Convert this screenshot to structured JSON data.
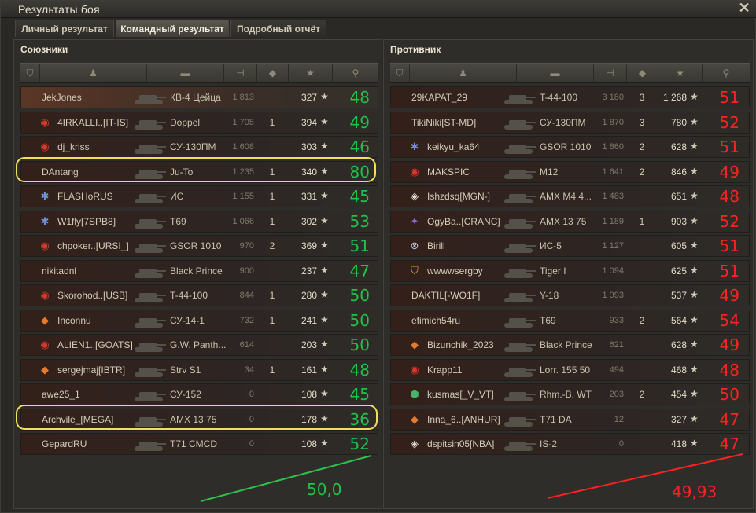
{
  "window": {
    "title": "Результаты боя"
  },
  "tabs": [
    {
      "label": "Личный результат",
      "active": false
    },
    {
      "label": "Командный результат",
      "active": true
    },
    {
      "label": "Подробный отчёт",
      "active": false
    }
  ],
  "allies": {
    "title": "Союзники",
    "total": "50,0",
    "rows": [
      {
        "player": "JekJones",
        "clan_icon": "",
        "vehicle": "КВ-4 Цейца",
        "damage": "1 813",
        "kills": "",
        "xp": "327",
        "note": "48",
        "style": "top"
      },
      {
        "player": "4IRKALLI..[IT-IS]",
        "clan_icon": "clan-emblem-red",
        "vehicle": "Doppel",
        "damage": "1 705",
        "kills": "1",
        "xp": "394",
        "note": "49",
        "style": "dark"
      },
      {
        "player": "dj_kriss",
        "clan_icon": "clan-emblem-red",
        "vehicle": "СУ-130ПМ",
        "damage": "1 608",
        "kills": "",
        "xp": "303",
        "note": "46",
        "style": "dark"
      },
      {
        "player": "DAntang",
        "clan_icon": "",
        "vehicle": "Ju-To",
        "damage": "1 235",
        "kills": "1",
        "xp": "340",
        "note": "80",
        "style": "dark"
      },
      {
        "player": "FLASHoRUS",
        "clan_icon": "clan-emblem-blue",
        "vehicle": "ИС",
        "damage": "1 155",
        "kills": "1",
        "xp": "331",
        "note": "45",
        "style": "dark"
      },
      {
        "player": "W1fly[7SPB8]",
        "clan_icon": "clan-emblem-blue",
        "vehicle": "T69",
        "damage": "1 066",
        "kills": "1",
        "xp": "302",
        "note": "53",
        "style": "dark"
      },
      {
        "player": "chpoker..[URSI_]",
        "clan_icon": "clan-emblem-red",
        "vehicle": "GSOR 1010",
        "damage": "970",
        "kills": "2",
        "xp": "369",
        "note": "51",
        "style": "dark"
      },
      {
        "player": "nikitadnl",
        "clan_icon": "",
        "vehicle": "Black Prince",
        "damage": "900",
        "kills": "",
        "xp": "237",
        "note": "47",
        "style": "dark"
      },
      {
        "player": "Skorohod..[USB]",
        "clan_icon": "clan-emblem-red",
        "vehicle": "T-44-100",
        "damage": "844",
        "kills": "1",
        "xp": "280",
        "note": "50",
        "style": "dark"
      },
      {
        "player": "Inconnu",
        "clan_icon": "clan-emblem-orange",
        "vehicle": "СУ-14-1",
        "damage": "732",
        "kills": "1",
        "xp": "241",
        "note": "50",
        "style": "dark"
      },
      {
        "player": "ALIEN1..[GOATS]",
        "clan_icon": "clan-emblem-red",
        "vehicle": "G.W. Panth...",
        "damage": "614",
        "kills": "",
        "xp": "203",
        "note": "50",
        "style": "dark"
      },
      {
        "player": "sergejmaj[IBTR]",
        "clan_icon": "clan-emblem-orange",
        "vehicle": "Strv S1",
        "damage": "34",
        "kills": "1",
        "xp": "161",
        "note": "48",
        "style": "dark"
      },
      {
        "player": "awe25_1",
        "clan_icon": "",
        "vehicle": "СУ-152",
        "damage": "0",
        "kills": "",
        "xp": "108",
        "note": "45",
        "style": "dark"
      },
      {
        "player": "Archvile_[MEGA]",
        "clan_icon": "",
        "vehicle": "AMX 13 75",
        "damage": "0",
        "kills": "",
        "xp": "178",
        "note": "36",
        "style": "dark"
      },
      {
        "player": "GepardRU",
        "clan_icon": "",
        "vehicle": "T71 CMCD",
        "damage": "0",
        "kills": "",
        "xp": "108",
        "note": "52",
        "style": "dark"
      }
    ]
  },
  "enemies": {
    "title": "Противник",
    "total": "49,93",
    "rows": [
      {
        "player": "29KAPAT_29",
        "clan_icon": "",
        "vehicle": "T-44-100",
        "damage": "3 180",
        "kills": "3",
        "xp": "1 268",
        "note": "51",
        "style": "dark"
      },
      {
        "player": "TikiNiki[ST-MD]",
        "clan_icon": "",
        "vehicle": "СУ-130ПМ",
        "damage": "1 870",
        "kills": "3",
        "xp": "780",
        "note": "52",
        "style": "dark"
      },
      {
        "player": "keikyu_ka64",
        "clan_icon": "clan-emblem-blue",
        "vehicle": "GSOR 1010",
        "damage": "1 860",
        "kills": "2",
        "xp": "628",
        "note": "51",
        "style": "dark"
      },
      {
        "player": "MAKSPIC",
        "clan_icon": "clan-emblem-red",
        "vehicle": "M12",
        "damage": "1 641",
        "kills": "2",
        "xp": "846",
        "note": "49",
        "style": "dark"
      },
      {
        "player": "Ishzdsq[MGN-]",
        "clan_icon": "clan-emblem-white",
        "vehicle": "AMX M4 4...",
        "damage": "1 483",
        "kills": "",
        "xp": "651",
        "note": "48",
        "style": "dark"
      },
      {
        "player": "OgyBa..[CRANC]",
        "clan_icon": "clan-emblem-purple",
        "vehicle": "AMX 13 75",
        "damage": "1 189",
        "kills": "1",
        "xp": "903",
        "note": "52",
        "style": "dark"
      },
      {
        "player": "Birill",
        "clan_icon": "clan-emblem-x",
        "vehicle": "ИС-5",
        "damage": "1 127",
        "kills": "",
        "xp": "605",
        "note": "51",
        "style": "dark"
      },
      {
        "player": "wwwwsergby",
        "clan_icon": "clan-emblem-shield",
        "vehicle": "Tiger I",
        "damage": "1 094",
        "kills": "",
        "xp": "625",
        "note": "51",
        "style": "dark"
      },
      {
        "player": "DAKTIL[-WO1F]",
        "clan_icon": "",
        "vehicle": "Y-18",
        "damage": "1 093",
        "kills": "",
        "xp": "537",
        "note": "49",
        "style": "dark"
      },
      {
        "player": "efimich54ru",
        "clan_icon": "",
        "vehicle": "T69",
        "damage": "933",
        "kills": "2",
        "xp": "564",
        "note": "54",
        "style": "dark"
      },
      {
        "player": "Bizunchik_2023",
        "clan_icon": "clan-emblem-orange",
        "vehicle": "Black Prince",
        "damage": "621",
        "kills": "",
        "xp": "628",
        "note": "49",
        "style": "dark"
      },
      {
        "player": "Krapp11",
        "clan_icon": "clan-emblem-red",
        "vehicle": "Lorr. 155 50",
        "damage": "494",
        "kills": "",
        "xp": "468",
        "note": "48",
        "style": "dark"
      },
      {
        "player": "kusmas[_V_VT]",
        "clan_icon": "clan-emblem-green",
        "vehicle": "Rhm.-B. WT",
        "damage": "203",
        "kills": "2",
        "xp": "454",
        "note": "50",
        "style": "dark"
      },
      {
        "player": "Inna_6..[ANHUR]",
        "clan_icon": "clan-emblem-orange",
        "vehicle": "T71 DA",
        "damage": "12",
        "kills": "",
        "xp": "327",
        "note": "47",
        "style": "dark"
      },
      {
        "player": "dspitsin05[NBA]",
        "clan_icon": "clan-emblem-white",
        "vehicle": "IS-2",
        "damage": "0",
        "kills": "",
        "xp": "418",
        "note": "47",
        "style": "dark"
      }
    ]
  },
  "colors": {
    "ally_note": "#1fc24a",
    "enemy_note": "#ff2222",
    "highlight": "#f0df5c"
  }
}
